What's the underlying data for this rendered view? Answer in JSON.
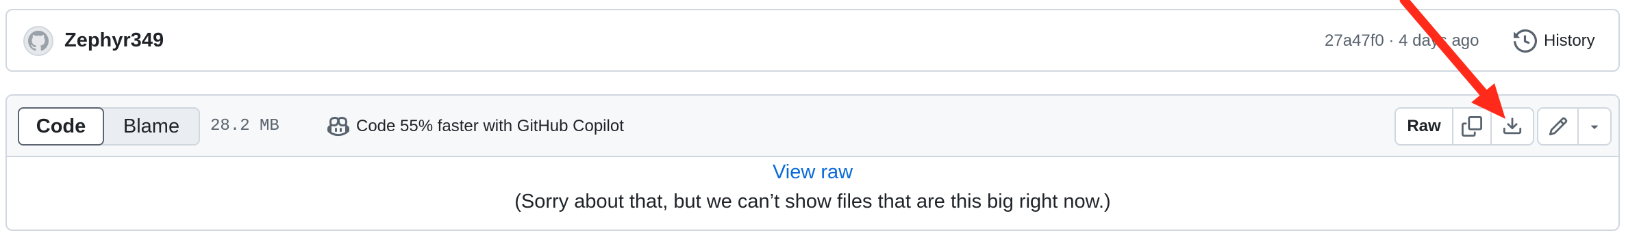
{
  "commit": {
    "author": "Zephyr349",
    "meta": "27a47f0 · 4 days ago",
    "history_label": "History"
  },
  "file": {
    "tabs": [
      {
        "label": "Code",
        "active": true
      },
      {
        "label": "Blame",
        "active": false
      }
    ],
    "size": "28.2 MB",
    "copilot_text": "Code 55% faster with GitHub Copilot",
    "raw_label": "Raw",
    "actions": [
      {
        "icon": "copy-icon"
      },
      {
        "icon": "download-icon"
      },
      {
        "icon": "pencil-icon"
      },
      {
        "icon": "triangle-down-icon"
      }
    ],
    "view_raw_link": "View raw",
    "too_big_message": "(Sorry about that, but we can’t show files that are this big right now.)"
  },
  "colors": {
    "accent_link": "#0969da",
    "border": "#d0d7de",
    "header_bg": "#f6f8fa",
    "annotation_arrow": "#ff2a1a"
  }
}
